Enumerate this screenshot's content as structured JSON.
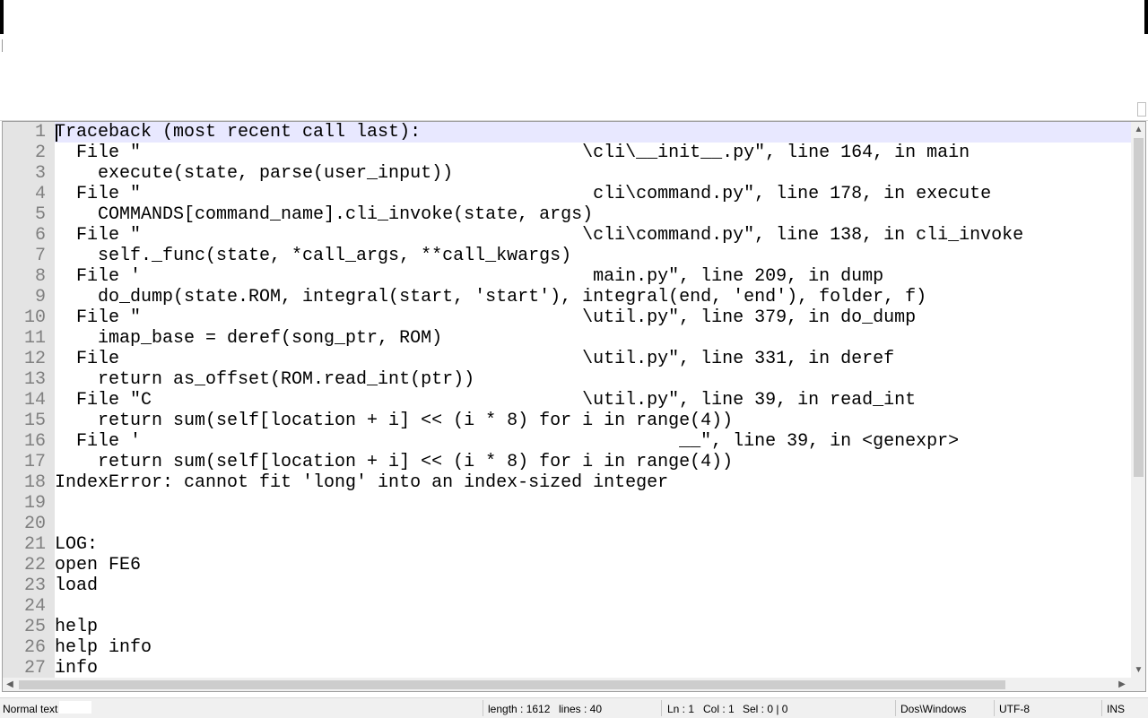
{
  "editor": {
    "lines": [
      {
        "num": "1",
        "text": "Traceback (most recent call last):"
      },
      {
        "num": "2",
        "text": "  File \"                                         \\cli\\__init__.py\", line 164, in main"
      },
      {
        "num": "3",
        "text": "    execute(state, parse(user_input))"
      },
      {
        "num": "4",
        "text": "  File \"                                          cli\\command.py\", line 178, in execute"
      },
      {
        "num": "5",
        "text": "    COMMANDS[command_name].cli_invoke(state, args)"
      },
      {
        "num": "6",
        "text": "  File \"                                         \\cli\\command.py\", line 138, in cli_invoke"
      },
      {
        "num": "7",
        "text": "    self._func(state, *call_args, **call_kwargs)"
      },
      {
        "num": "8",
        "text": "  File '                                          main.py\", line 209, in dump"
      },
      {
        "num": "9",
        "text": "    do_dump(state.ROM, integral(start, 'start'), integral(end, 'end'), folder, f)"
      },
      {
        "num": "10",
        "text": "  File \"                                         \\util.py\", line 379, in do_dump"
      },
      {
        "num": "11",
        "text": "    imap_base = deref(song_ptr, ROM)"
      },
      {
        "num": "12",
        "text": "  File                                           \\util.py\", line 331, in deref"
      },
      {
        "num": "13",
        "text": "    return as_offset(ROM.read_int(ptr))"
      },
      {
        "num": "14",
        "text": "  File \"C                                        \\util.py\", line 39, in read_int"
      },
      {
        "num": "15",
        "text": "    return sum(self[location + i] << (i * 8) for i in range(4))"
      },
      {
        "num": "16",
        "text": "  File '                                                  __\", line 39, in <genexpr>"
      },
      {
        "num": "17",
        "text": "    return sum(self[location + i] << (i * 8) for i in range(4))"
      },
      {
        "num": "18",
        "text": "IndexError: cannot fit 'long' into an index-sized integer"
      },
      {
        "num": "19",
        "text": ""
      },
      {
        "num": "20",
        "text": ""
      },
      {
        "num": "21",
        "text": "LOG:"
      },
      {
        "num": "22",
        "text": "open FE6"
      },
      {
        "num": "23",
        "text": "load"
      },
      {
        "num": "24",
        "text": ""
      },
      {
        "num": "25",
        "text": "help"
      },
      {
        "num": "26",
        "text": "help info"
      },
      {
        "num": "27",
        "text": "info"
      }
    ]
  },
  "scrollbars": {
    "up": "▲",
    "down": "▼",
    "left": "◀",
    "right": "▶"
  },
  "statusbar": {
    "language": "Normal text",
    "length": "length : 1612",
    "lines": "lines : 40",
    "ln": "Ln : 1",
    "col": "Col : 1",
    "sel": "Sel : 0 | 0",
    "eol": "Dos\\Windows",
    "encoding": "UTF-8",
    "mode": "INS"
  }
}
